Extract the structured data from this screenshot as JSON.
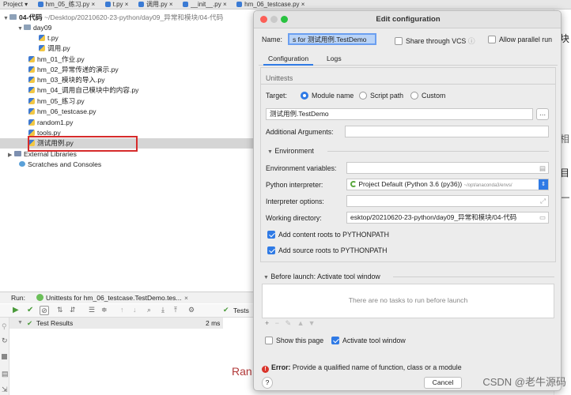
{
  "top_tabs": [
    "Project ▾",
    "hm_05_练习.py ×",
    "t.py ×",
    "调用.py ×",
    "__init__.py ×",
    "hm_06_testcase.py ×"
  ],
  "project_tree": {
    "root_label": "04-代码",
    "root_path": "~/Desktop/20210620-23-python/day09_异常和模块/04-代码",
    "subfolder": "day09",
    "subfolder_files": [
      "t.py",
      "调用.py"
    ],
    "files": [
      "hm_01_作业.py",
      "hm_02_异常传递的演示.py",
      "hm_03_模块的导入.py",
      "hm_04_调用自己模块中的内容.py",
      "hm_05_练习.py",
      "hm_06_testcase.py",
      "random1.py",
      "tools.py",
      "测试用例.py"
    ],
    "external_libraries": "External Libraries",
    "scratches": "Scratches and Consoles"
  },
  "run_panel": {
    "run_label": "Run:",
    "run_tab": "Unittests for hm_06_testcase.TestDemo.tes...",
    "test_results": "Test Results",
    "duration": "2 ms",
    "tests_label": "Tests",
    "partial_text": "Ran"
  },
  "right_partial_chars": [
    "块",
    "相",
    "目",
    "—"
  ],
  "dialog": {
    "title": "Edit configuration",
    "name_label": "Name:",
    "name_value": "s for 测试用例.TestDemo",
    "share_vcs": "Share through VCS",
    "allow_parallel": "Allow parallel run",
    "tabs": [
      "Configuration",
      "Logs"
    ],
    "unittests_label": "Unittests",
    "target_label": "Target:",
    "target_options": [
      "Module name",
      "Script path",
      "Custom"
    ],
    "target_value": "测试用例.TestDemo",
    "additional_args_label": "Additional Arguments:",
    "environment_label": "Environment",
    "env_vars_label": "Environment variables:",
    "interpreter_label": "Python interpreter:",
    "interpreter_value": "Project Default (Python 3.6 (py36))",
    "interpreter_path": "~/opt/anaconda3/envs/",
    "interpreter_options_label": "Interpreter options:",
    "working_dir_label": "Working directory:",
    "working_dir_value": "esktop/20210620-23-python/day09_异常和模块/04-代码",
    "add_content_roots": "Add content roots to PYTHONPATH",
    "add_source_roots": "Add source roots to PYTHONPATH",
    "before_launch": "Before launch: Activate tool window",
    "no_tasks": "There are no tasks to run before launch",
    "show_page": "Show this page",
    "activate_tool": "Activate tool window",
    "error_label": "Error:",
    "error_text": "Provide a qualified name of function, class or a module",
    "help": "?",
    "cancel": "Cancel"
  },
  "watermark": "CSDN @老牛源码",
  "colors": {
    "accent": "#2f7ae5",
    "error": "#d9342b",
    "highlight_box": "#d62b2b"
  }
}
